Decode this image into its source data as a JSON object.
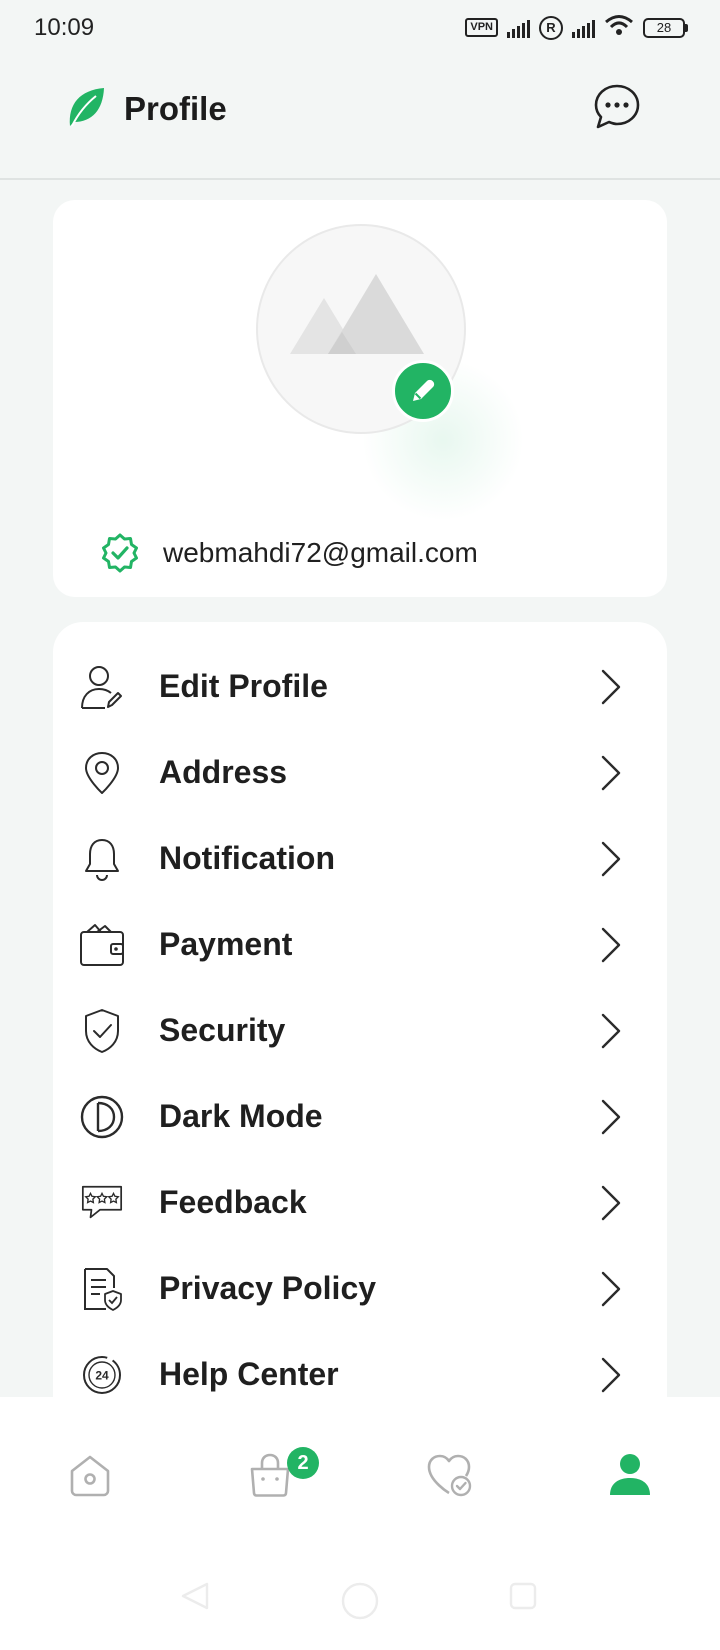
{
  "status_bar": {
    "time": "10:09",
    "vpn_label": "VPN",
    "roaming_label": "R",
    "battery": "28"
  },
  "header": {
    "title": "Profile",
    "logo_icon": "leaf-icon",
    "chat_icon": "chat-bubble-dots-icon",
    "accent_color": "#22b464"
  },
  "profile": {
    "email": "webmahdi72@gmail.com",
    "verified_icon": "verified-badge-icon",
    "avatar_icon": "image-placeholder-icon",
    "edit_icon": "pencil-icon"
  },
  "menu": {
    "items": [
      {
        "label": "Edit Profile",
        "icon": "user-edit-icon"
      },
      {
        "label": "Address",
        "icon": "location-pin-icon"
      },
      {
        "label": "Notification",
        "icon": "bell-icon"
      },
      {
        "label": "Payment",
        "icon": "wallet-icon"
      },
      {
        "label": "Security",
        "icon": "shield-check-icon"
      },
      {
        "label": "Dark Mode",
        "icon": "contrast-icon"
      },
      {
        "label": "Feedback",
        "icon": "feedback-stars-icon"
      },
      {
        "label": "Privacy Policy",
        "icon": "document-check-icon"
      },
      {
        "label": "Help Center",
        "icon": "clock-24-icon"
      }
    ]
  },
  "bottom_nav": {
    "tabs": [
      {
        "name": "home",
        "icon": "home-icon",
        "active": false
      },
      {
        "name": "cart",
        "icon": "shopping-bag-icon",
        "active": false,
        "badge": "2"
      },
      {
        "name": "wishlist",
        "icon": "heart-check-icon",
        "active": false
      },
      {
        "name": "profile",
        "icon": "user-icon",
        "active": true
      }
    ]
  }
}
